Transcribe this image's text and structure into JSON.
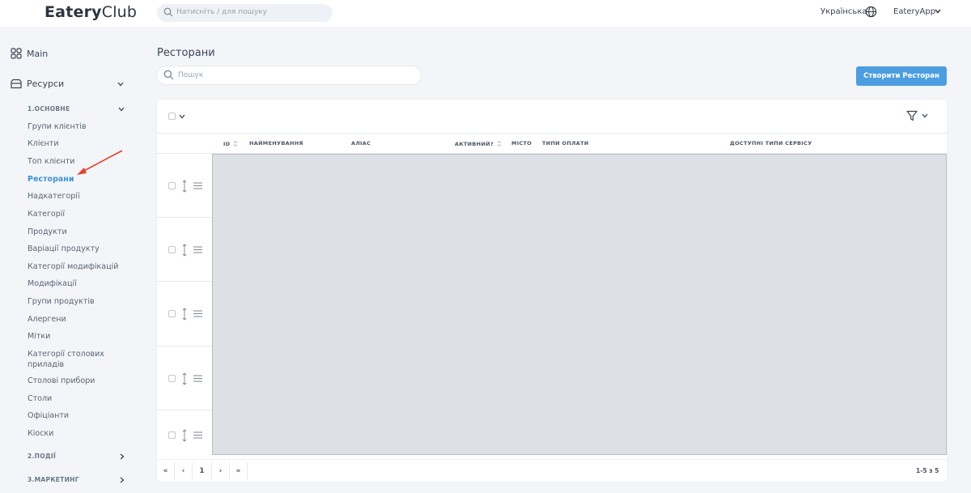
{
  "header": {
    "logo_bold": "Eatery",
    "logo_thin": "Club",
    "search_placeholder": "Натисніть / для пошуку",
    "language": "Українська",
    "user": "EateryApp"
  },
  "sidebar": {
    "main": "Main",
    "resources": "Ресурси",
    "group_basic": "1.ОСНОВНЕ",
    "items": [
      "Групи клієнтів",
      "Клієнти",
      "Топ клієнти",
      "Ресторани",
      "Надкатегорії",
      "Категорії",
      "Продукти",
      "Варіації продукту",
      "Категорії модифікацій",
      "Модифікації",
      "Групи продуктів",
      "Алергени",
      "Мітки",
      "Категорії столових приладів",
      "Столові прибори",
      "Столи",
      "Офіціанти",
      "Кіоски"
    ],
    "active_item": "Ресторани",
    "group_events": "2.ПОДІЇ",
    "group_marketing": "3.МАРКЕТИНГ"
  },
  "main": {
    "title": "Ресторани",
    "search_placeholder": "Пошук",
    "create_button": "Створити Ресторан",
    "columns": {
      "id": "ID",
      "name": "НАЙМЕНУВАННЯ",
      "alias": "АЛІАС",
      "active": "АКТИВНИЙ?",
      "city": "МІСТО",
      "payment": "ТИПИ ОПЛАТИ",
      "service": "ДОСТУПНІ ТИПИ СЕРВІСУ"
    },
    "pagination": {
      "first": "«",
      "prev": "‹",
      "page": "1",
      "next": "›",
      "last": "»",
      "range": "1-5 з 5"
    }
  },
  "colors": {
    "accent": "#3d92d6",
    "button": "#4d9ee0",
    "arrow": "#e2442f"
  }
}
